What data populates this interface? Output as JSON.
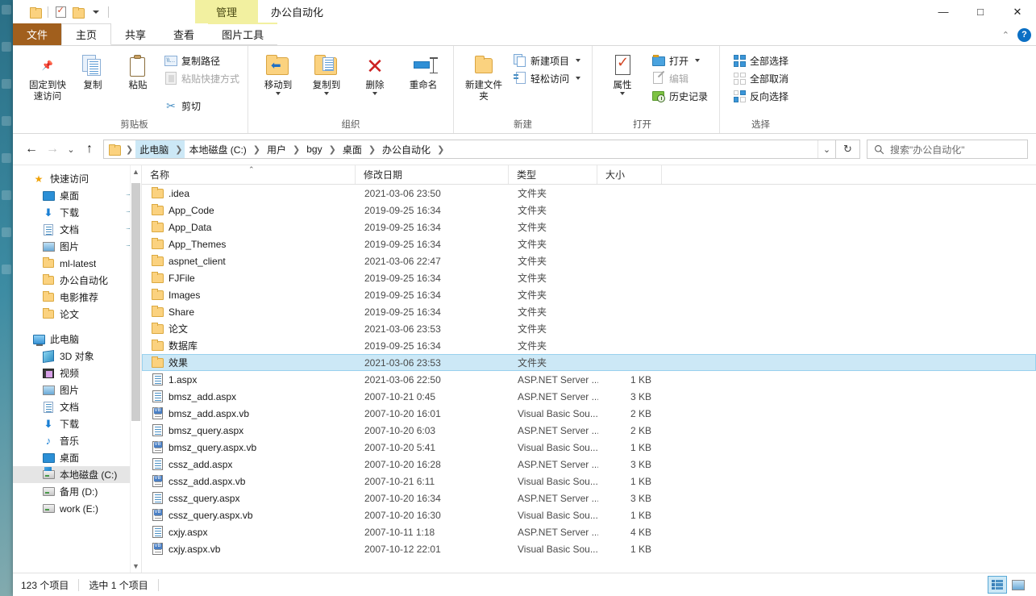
{
  "window": {
    "title": "办公自动化",
    "contextual_tab": "管理",
    "controls": {
      "minimize": "—",
      "maximize": "□",
      "close": "✕"
    }
  },
  "quick_access_toolbar": {
    "items": [
      {
        "name": "folder-icon",
        "label": ""
      },
      {
        "name": "properties-icon",
        "label": ""
      },
      {
        "name": "folder-icon-2",
        "label": ""
      },
      {
        "name": "customize-caret",
        "label": ""
      }
    ]
  },
  "tabs": [
    {
      "label": "文件",
      "kind": "file"
    },
    {
      "label": "主页",
      "kind": "active"
    },
    {
      "label": "共享",
      "kind": "normal"
    },
    {
      "label": "查看",
      "kind": "normal"
    },
    {
      "label": "图片工具",
      "kind": "contextual"
    }
  ],
  "ribbon_right": {
    "collapse": "⌃",
    "help": "?"
  },
  "ribbon": {
    "groups": [
      {
        "label": "剪贴板",
        "big_buttons": [
          {
            "label": "固定到快速访问",
            "icon": "pin-icon",
            "two_line": true
          },
          {
            "label": "复制",
            "icon": "copy-icon",
            "two_line": false
          },
          {
            "label": "粘贴",
            "icon": "paste-icon",
            "two_line": false
          }
        ],
        "small_buttons": [
          {
            "label": "复制路径",
            "icon": "copy-path-icon",
            "disabled": false
          },
          {
            "label": "粘贴快捷方式",
            "icon": "paste-shortcut-icon",
            "disabled": true
          },
          {
            "label": "剪切",
            "icon": "scissors-icon",
            "disabled": false
          }
        ]
      },
      {
        "label": "组织",
        "big_buttons": [
          {
            "label": "移动到",
            "icon": "move-to-icon",
            "caret": true
          },
          {
            "label": "复制到",
            "icon": "copy-to-icon",
            "caret": true
          },
          {
            "label": "删除",
            "icon": "delete-icon",
            "caret": true
          },
          {
            "label": "重命名",
            "icon": "rename-icon",
            "caret": false
          }
        ],
        "small_buttons": []
      },
      {
        "label": "新建",
        "big_buttons": [
          {
            "label": "新建文件夹",
            "icon": "new-folder-icon",
            "two_line": true
          }
        ],
        "small_buttons": [
          {
            "label": "新建项目",
            "icon": "new-item-icon",
            "caret": true
          },
          {
            "label": "轻松访问",
            "icon": "easy-access-icon",
            "caret": true
          }
        ]
      },
      {
        "label": "打开",
        "big_buttons": [
          {
            "label": "属性",
            "icon": "properties-icon",
            "caret": true
          }
        ],
        "small_buttons": [
          {
            "label": "打开",
            "icon": "open-icon",
            "caret": true
          },
          {
            "label": "编辑",
            "icon": "edit-icon",
            "disabled": true
          },
          {
            "label": "历史记录",
            "icon": "history-icon"
          }
        ]
      },
      {
        "label": "选择",
        "big_buttons": [],
        "small_buttons": [
          {
            "label": "全部选择",
            "icon": "select-all-icon"
          },
          {
            "label": "全部取消",
            "icon": "select-none-icon"
          },
          {
            "label": "反向选择",
            "icon": "invert-selection-icon"
          }
        ]
      }
    ]
  },
  "address_bar": {
    "back": "←",
    "forward": "→",
    "recent": "⌄",
    "up": "↑",
    "breadcrumbs": [
      {
        "label": "此电脑",
        "highlighted": true
      },
      {
        "label": "本地磁盘 (C:)",
        "highlighted": false
      },
      {
        "label": "用户",
        "highlighted": false
      },
      {
        "label": "bgy",
        "highlighted": false
      },
      {
        "label": "桌面",
        "highlighted": false
      },
      {
        "label": "办公自动化",
        "highlighted": false
      }
    ],
    "dropdown": "⌄",
    "refresh": "↻",
    "search_placeholder": "搜索\"办公自动化\""
  },
  "nav_pane": {
    "items": [
      {
        "label": "快速访问",
        "icon": "star-pin-icon",
        "indent": 0,
        "pin": false,
        "selected": false
      },
      {
        "label": "桌面",
        "icon": "desktop-icon",
        "indent": 1,
        "pin": true,
        "selected": false
      },
      {
        "label": "下载",
        "icon": "downloads-icon",
        "indent": 1,
        "pin": true,
        "selected": false
      },
      {
        "label": "文档",
        "icon": "documents-icon",
        "indent": 1,
        "pin": true,
        "selected": false
      },
      {
        "label": "图片",
        "icon": "pictures-icon",
        "indent": 1,
        "pin": true,
        "selected": false
      },
      {
        "label": "ml-latest",
        "icon": "folder-icon",
        "indent": 1,
        "pin": false,
        "selected": false
      },
      {
        "label": "办公自动化",
        "icon": "folder-icon",
        "indent": 1,
        "pin": false,
        "selected": false
      },
      {
        "label": "电影推荐",
        "icon": "folder-icon",
        "indent": 1,
        "pin": false,
        "selected": false
      },
      {
        "label": "论文",
        "icon": "folder-icon",
        "indent": 1,
        "pin": false,
        "selected": false
      },
      {
        "label": "此电脑",
        "icon": "this-pc-icon",
        "indent": 0,
        "pin": false,
        "selected": false
      },
      {
        "label": "3D 对象",
        "icon": "3d-objects-icon",
        "indent": 1,
        "pin": false,
        "selected": false
      },
      {
        "label": "视频",
        "icon": "videos-icon",
        "indent": 1,
        "pin": false,
        "selected": false
      },
      {
        "label": "图片",
        "icon": "pictures-icon",
        "indent": 1,
        "pin": false,
        "selected": false
      },
      {
        "label": "文档",
        "icon": "documents-icon",
        "indent": 1,
        "pin": false,
        "selected": false
      },
      {
        "label": "下载",
        "icon": "downloads-icon",
        "indent": 1,
        "pin": false,
        "selected": false
      },
      {
        "label": "音乐",
        "icon": "music-icon",
        "indent": 1,
        "pin": false,
        "selected": false
      },
      {
        "label": "桌面",
        "icon": "desktop-icon",
        "indent": 1,
        "pin": false,
        "selected": false
      },
      {
        "label": "本地磁盘 (C:)",
        "icon": "windows-drive-icon",
        "indent": 1,
        "pin": false,
        "selected": true
      },
      {
        "label": "备用 (D:)",
        "icon": "drive-icon",
        "indent": 1,
        "pin": false,
        "selected": false
      },
      {
        "label": "work (E:)",
        "icon": "drive-icon",
        "indent": 1,
        "pin": false,
        "selected": false
      }
    ]
  },
  "file_list": {
    "columns": [
      {
        "label": "名称",
        "key": "name",
        "sorted": true,
        "sort_dir": "asc"
      },
      {
        "label": "修改日期",
        "key": "date"
      },
      {
        "label": "类型",
        "key": "type"
      },
      {
        "label": "大小",
        "key": "size"
      }
    ],
    "rows": [
      {
        "name": ".idea",
        "date": "2021-03-06 23:50",
        "type": "文件夹",
        "size": "",
        "icon": "folder-icon",
        "selected": false
      },
      {
        "name": "App_Code",
        "date": "2019-09-25 16:34",
        "type": "文件夹",
        "size": "",
        "icon": "folder-icon",
        "selected": false
      },
      {
        "name": "App_Data",
        "date": "2019-09-25 16:34",
        "type": "文件夹",
        "size": "",
        "icon": "folder-icon",
        "selected": false
      },
      {
        "name": "App_Themes",
        "date": "2019-09-25 16:34",
        "type": "文件夹",
        "size": "",
        "icon": "folder-icon",
        "selected": false
      },
      {
        "name": "aspnet_client",
        "date": "2021-03-06 22:47",
        "type": "文件夹",
        "size": "",
        "icon": "folder-icon",
        "selected": false
      },
      {
        "name": "FJFile",
        "date": "2019-09-25 16:34",
        "type": "文件夹",
        "size": "",
        "icon": "folder-icon",
        "selected": false
      },
      {
        "name": "Images",
        "date": "2019-09-25 16:34",
        "type": "文件夹",
        "size": "",
        "icon": "folder-icon",
        "selected": false
      },
      {
        "name": "Share",
        "date": "2019-09-25 16:34",
        "type": "文件夹",
        "size": "",
        "icon": "folder-icon",
        "selected": false
      },
      {
        "name": "论文",
        "date": "2021-03-06 23:53",
        "type": "文件夹",
        "size": "",
        "icon": "folder-icon",
        "selected": false
      },
      {
        "name": "数据库",
        "date": "2019-09-25 16:34",
        "type": "文件夹",
        "size": "",
        "icon": "folder-icon",
        "selected": false
      },
      {
        "name": "效果",
        "date": "2021-03-06 23:53",
        "type": "文件夹",
        "size": "",
        "icon": "folder-icon",
        "selected": true
      },
      {
        "name": "1.aspx",
        "date": "2021-03-06 22:50",
        "type": "ASP.NET Server ...",
        "size": "1 KB",
        "icon": "aspx-icon",
        "selected": false
      },
      {
        "name": "bmsz_add.aspx",
        "date": "2007-10-21 0:45",
        "type": "ASP.NET Server ...",
        "size": "3 KB",
        "icon": "aspx-icon",
        "selected": false
      },
      {
        "name": "bmsz_add.aspx.vb",
        "date": "2007-10-20 16:01",
        "type": "Visual Basic Sou...",
        "size": "2 KB",
        "icon": "vb-icon",
        "selected": false
      },
      {
        "name": "bmsz_query.aspx",
        "date": "2007-10-20 6:03",
        "type": "ASP.NET Server ...",
        "size": "2 KB",
        "icon": "aspx-icon",
        "selected": false
      },
      {
        "name": "bmsz_query.aspx.vb",
        "date": "2007-10-20 5:41",
        "type": "Visual Basic Sou...",
        "size": "1 KB",
        "icon": "vb-icon",
        "selected": false
      },
      {
        "name": "cssz_add.aspx",
        "date": "2007-10-20 16:28",
        "type": "ASP.NET Server ...",
        "size": "3 KB",
        "icon": "aspx-icon",
        "selected": false
      },
      {
        "name": "cssz_add.aspx.vb",
        "date": "2007-10-21 6:11",
        "type": "Visual Basic Sou...",
        "size": "1 KB",
        "icon": "vb-icon",
        "selected": false
      },
      {
        "name": "cssz_query.aspx",
        "date": "2007-10-20 16:34",
        "type": "ASP.NET Server ...",
        "size": "3 KB",
        "icon": "aspx-icon",
        "selected": false
      },
      {
        "name": "cssz_query.aspx.vb",
        "date": "2007-10-20 16:30",
        "type": "Visual Basic Sou...",
        "size": "1 KB",
        "icon": "vb-icon",
        "selected": false
      },
      {
        "name": "cxjy.aspx",
        "date": "2007-10-11 1:18",
        "type": "ASP.NET Server ...",
        "size": "4 KB",
        "icon": "aspx-icon",
        "selected": false
      },
      {
        "name": "cxjy.aspx.vb",
        "date": "2007-10-12 22:01",
        "type": "Visual Basic Sou...",
        "size": "1 KB",
        "icon": "vb-icon",
        "selected": false
      }
    ]
  },
  "status_bar": {
    "item_count": "123 个项目",
    "selection": "选中 1 个项目",
    "view_details": "details-view",
    "view_thumbnails": "thumbnails-view"
  },
  "colors": {
    "accent": "#cce8f6",
    "file_tab": "#a15f1d",
    "contextual": "#f2f0a0",
    "folder": "#fbd27f"
  }
}
